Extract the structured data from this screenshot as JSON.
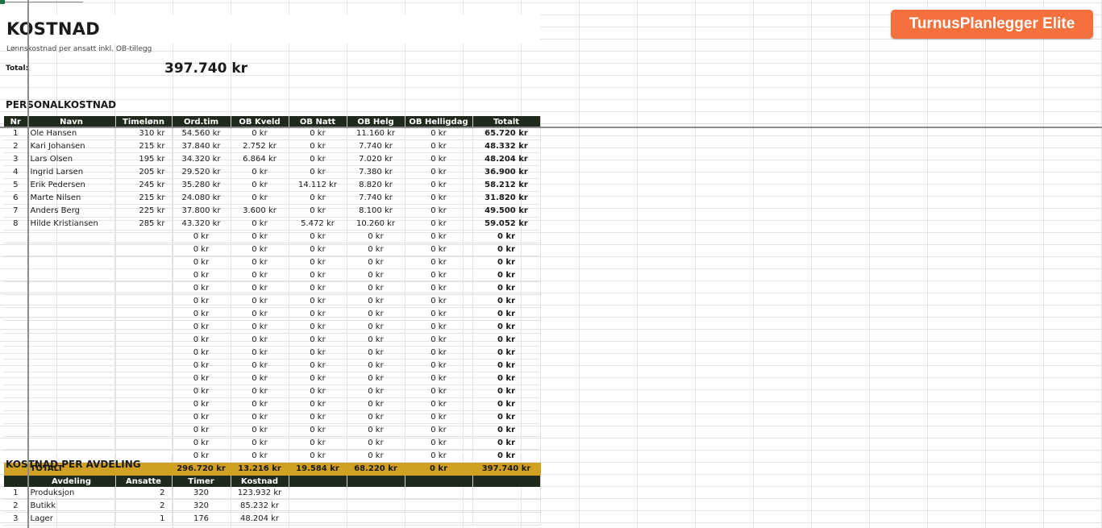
{
  "header": {
    "title": "KOSTNAD",
    "subtitle": "Lønnskostnad per ansatt inkl. OB-tillegg",
    "total_label": "Total:",
    "total_value": "397.740 kr",
    "brand_label": "TurnusPlanlegger Elite"
  },
  "personal": {
    "section_title": "PERSONALKOSTNAD",
    "columns": [
      "Nr",
      "Navn",
      "Timelønn",
      "Ord.tim",
      "OB Kveld",
      "OB Natt",
      "OB Helg",
      "OB Helligdag",
      "Totalt"
    ],
    "rows": [
      [
        "1",
        "Ole Hansen",
        "310 kr",
        "54.560 kr",
        "0 kr",
        "0 kr",
        "11.160 kr",
        "0 kr",
        "65.720 kr"
      ],
      [
        "2",
        "Kari Johansen",
        "215 kr",
        "37.840 kr",
        "2.752 kr",
        "0 kr",
        "7.740 kr",
        "0 kr",
        "48.332 kr"
      ],
      [
        "3",
        "Lars Olsen",
        "195 kr",
        "34.320 kr",
        "6.864 kr",
        "0 kr",
        "7.020 kr",
        "0 kr",
        "48.204 kr"
      ],
      [
        "4",
        "Ingrid Larsen",
        "205 kr",
        "29.520 kr",
        "0 kr",
        "0 kr",
        "7.380 kr",
        "0 kr",
        "36.900 kr"
      ],
      [
        "5",
        "Erik Pedersen",
        "245 kr",
        "35.280 kr",
        "0 kr",
        "14.112 kr",
        "8.820 kr",
        "0 kr",
        "58.212 kr"
      ],
      [
        "6",
        "Marte Nilsen",
        "215 kr",
        "24.080 kr",
        "0 kr",
        "0 kr",
        "7.740 kr",
        "0 kr",
        "31.820 kr"
      ],
      [
        "7",
        "Anders Berg",
        "225 kr",
        "37.800 kr",
        "3.600 kr",
        "0 kr",
        "8.100 kr",
        "0 kr",
        "49.500 kr"
      ],
      [
        "8",
        "Hilde Kristiansen",
        "285 kr",
        "43.320 kr",
        "0 kr",
        "5.472 kr",
        "10.260 kr",
        "0 kr",
        "59.052 kr"
      ],
      [
        "",
        "",
        "",
        "0 kr",
        "0 kr",
        "0 kr",
        "0 kr",
        "0 kr",
        "0 kr"
      ],
      [
        "",
        "",
        "",
        "0 kr",
        "0 kr",
        "0 kr",
        "0 kr",
        "0 kr",
        "0 kr"
      ],
      [
        "",
        "",
        "",
        "0 kr",
        "0 kr",
        "0 kr",
        "0 kr",
        "0 kr",
        "0 kr"
      ],
      [
        "",
        "",
        "",
        "0 kr",
        "0 kr",
        "0 kr",
        "0 kr",
        "0 kr",
        "0 kr"
      ],
      [
        "",
        "",
        "",
        "0 kr",
        "0 kr",
        "0 kr",
        "0 kr",
        "0 kr",
        "0 kr"
      ],
      [
        "",
        "",
        "",
        "0 kr",
        "0 kr",
        "0 kr",
        "0 kr",
        "0 kr",
        "0 kr"
      ],
      [
        "",
        "",
        "",
        "0 kr",
        "0 kr",
        "0 kr",
        "0 kr",
        "0 kr",
        "0 kr"
      ],
      [
        "",
        "",
        "",
        "0 kr",
        "0 kr",
        "0 kr",
        "0 kr",
        "0 kr",
        "0 kr"
      ],
      [
        "",
        "",
        "",
        "0 kr",
        "0 kr",
        "0 kr",
        "0 kr",
        "0 kr",
        "0 kr"
      ],
      [
        "",
        "",
        "",
        "0 kr",
        "0 kr",
        "0 kr",
        "0 kr",
        "0 kr",
        "0 kr"
      ],
      [
        "",
        "",
        "",
        "0 kr",
        "0 kr",
        "0 kr",
        "0 kr",
        "0 kr",
        "0 kr"
      ],
      [
        "",
        "",
        "",
        "0 kr",
        "0 kr",
        "0 kr",
        "0 kr",
        "0 kr",
        "0 kr"
      ],
      [
        "",
        "",
        "",
        "0 kr",
        "0 kr",
        "0 kr",
        "0 kr",
        "0 kr",
        "0 kr"
      ],
      [
        "",
        "",
        "",
        "0 kr",
        "0 kr",
        "0 kr",
        "0 kr",
        "0 kr",
        "0 kr"
      ],
      [
        "",
        "",
        "",
        "0 kr",
        "0 kr",
        "0 kr",
        "0 kr",
        "0 kr",
        "0 kr"
      ],
      [
        "",
        "",
        "",
        "0 kr",
        "0 kr",
        "0 kr",
        "0 kr",
        "0 kr",
        "0 kr"
      ],
      [
        "",
        "",
        "",
        "0 kr",
        "0 kr",
        "0 kr",
        "0 kr",
        "0 kr",
        "0 kr"
      ],
      [
        "",
        "",
        "",
        "0 kr",
        "0 kr",
        "0 kr",
        "0 kr",
        "0 kr",
        "0 kr"
      ]
    ],
    "total_row": [
      "",
      "TOTALT",
      "",
      "296.720 kr",
      "13.216 kr",
      "19.584 kr",
      "68.220 kr",
      "0 kr",
      "397.740 kr"
    ]
  },
  "department": {
    "section_title": "KOSTNAD PER AVDELING",
    "columns": [
      "",
      "Avdeling",
      "Ansatte",
      "Timer",
      "Kostnad",
      "",
      "",
      "",
      ""
    ],
    "rows": [
      [
        "1",
        "Produksjon",
        "2",
        "320",
        "123.932 kr",
        "",
        "",
        "",
        ""
      ],
      [
        "2",
        "Butikk",
        "2",
        "320",
        "85.232 kr",
        "",
        "",
        "",
        ""
      ],
      [
        "3",
        "Lager",
        "1",
        "176",
        "48.204 kr",
        "",
        "",
        "",
        ""
      ]
    ]
  },
  "colors": {
    "header_bg": "#1f2a1c",
    "total_bg": "#d0a023",
    "brand_bg": "#f4703c"
  }
}
